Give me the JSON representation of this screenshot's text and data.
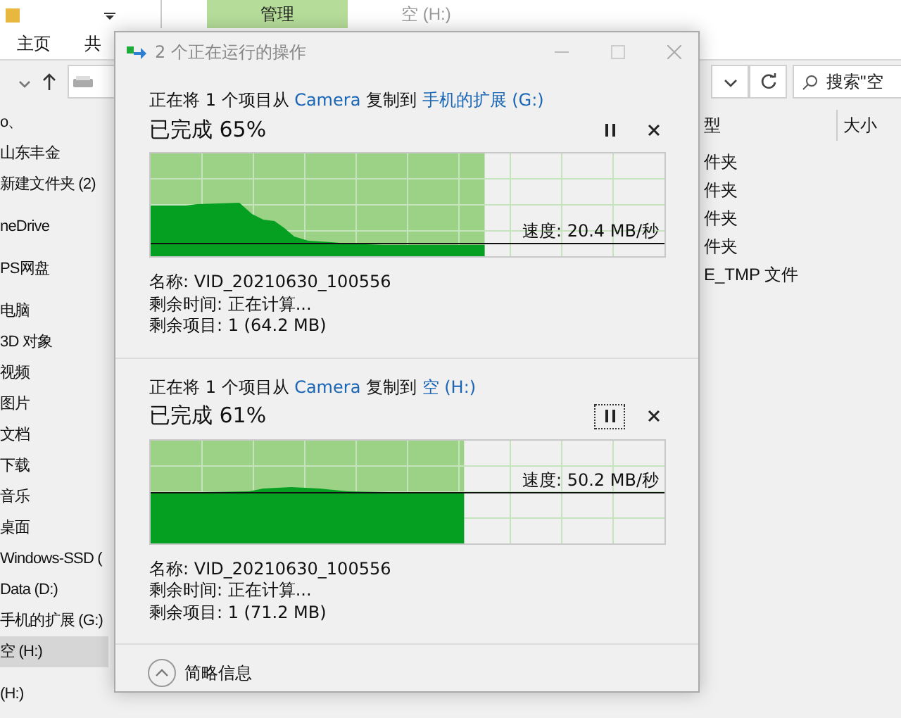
{
  "explorer": {
    "title_tabs": [
      {
        "label": "管理",
        "selected": true
      },
      {
        "label": "空 (H:)",
        "selected": false
      }
    ],
    "ribbon_tabs": [
      "主页",
      "共"
    ],
    "search": {
      "placeholder": "搜索\"空"
    },
    "nav_groups": [
      [
        {
          "label": "o、",
          "selected": false
        },
        {
          "label": "山东丰金",
          "selected": false
        },
        {
          "label": "新建文件夹 (2)",
          "selected": false
        }
      ],
      [
        {
          "label": "neDrive",
          "selected": false
        }
      ],
      [
        {
          "label": "PS网盘",
          "selected": false
        }
      ],
      [
        {
          "label": "电脑",
          "selected": false
        },
        {
          "label": "3D 对象",
          "selected": false
        },
        {
          "label": "视频",
          "selected": false
        },
        {
          "label": "图片",
          "selected": false
        },
        {
          "label": "文档",
          "selected": false
        },
        {
          "label": "下载",
          "selected": false
        },
        {
          "label": "音乐",
          "selected": false
        },
        {
          "label": "桌面",
          "selected": false
        },
        {
          "label": "Windows-SSD (",
          "selected": false
        },
        {
          "label": "Data (D:)",
          "selected": false
        },
        {
          "label": "手机的扩展 (G:)",
          "selected": false
        },
        {
          "label": "空 (H:)",
          "selected": true
        }
      ],
      [
        {
          "label": "(H:)",
          "selected": false
        }
      ]
    ],
    "columns": [
      "型",
      "大小"
    ],
    "rows": [
      "件夹",
      "件夹",
      "件夹",
      "件夹",
      "E_TMP 文件"
    ]
  },
  "dialog": {
    "title": "2 个正在运行的操作",
    "operations": [
      {
        "prefix": "正在将 1 个项目从",
        "source": "Camera",
        "verb": "复制到",
        "destination": "手机的扩展 (G:)",
        "progress": "已完成 65%",
        "level": 0.65,
        "speed": "速度: 20.4 MB/秒",
        "name": "名称: VID_20210630_100556",
        "time_left": "剩余时间: 正在计算...",
        "items_left": "剩余项目: 1 (64.2 MB)",
        "pause_focused": false
      },
      {
        "prefix": "正在将 1 个项目从",
        "source": "Camera",
        "verb": "复制到",
        "destination": "空 (H:)",
        "progress": "已完成 61%",
        "level": 0.61,
        "speed": "速度: 50.2 MB/秒",
        "name": "名称: VID_20210630_100556",
        "time_left": "剩余时间: 正在计算...",
        "items_left": "剩余项目: 1 (71.2 MB)",
        "pause_focused": true
      }
    ],
    "details_toggle": "简略信息"
  }
}
